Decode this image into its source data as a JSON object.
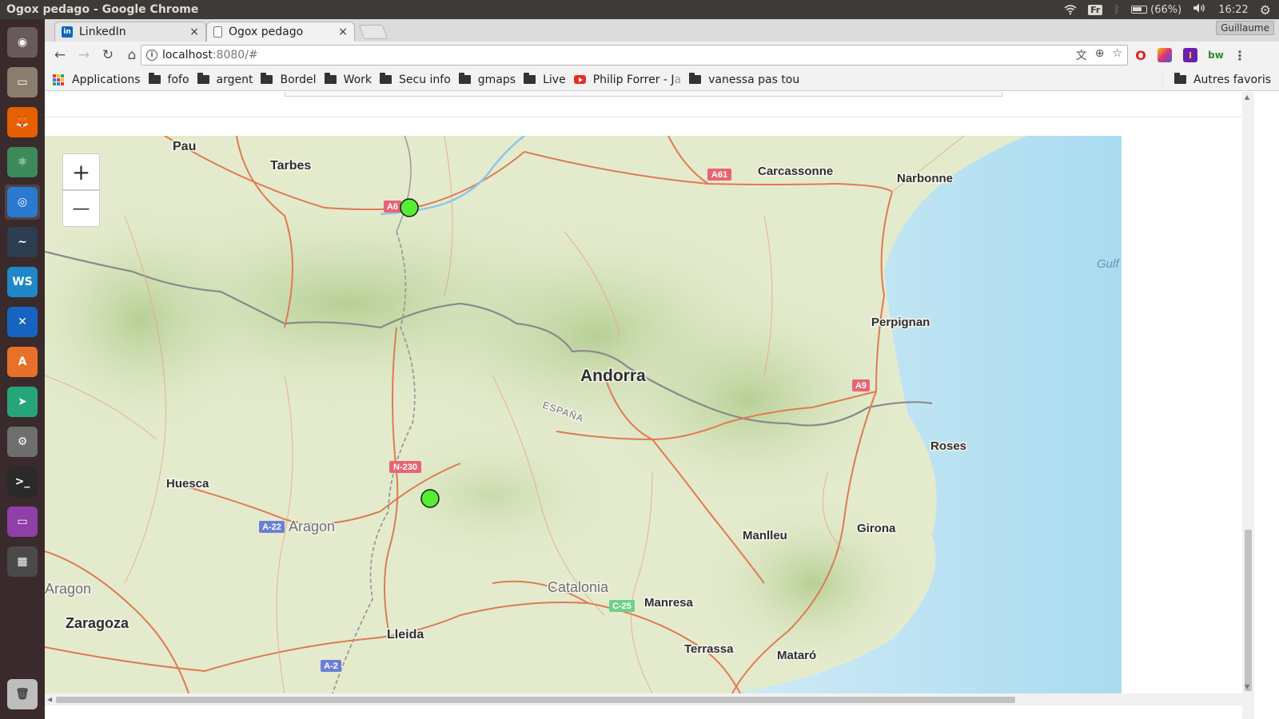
{
  "os": {
    "window_title": "Ogox pedago - Google Chrome",
    "keyboard_layout": "Fr",
    "battery": "(66%)",
    "clock": "16:22"
  },
  "launcher": {
    "items": [
      {
        "name": "ubuntu-home",
        "color": "#6a5a5a",
        "glyph": "◉"
      },
      {
        "name": "files",
        "color": "#8c7d6e",
        "glyph": "▭"
      },
      {
        "name": "firefox",
        "color": "#e66000",
        "glyph": "🦊"
      },
      {
        "name": "atom",
        "color": "#3c8a5a",
        "glyph": "⚛"
      },
      {
        "name": "chrome",
        "color": "#2a7ad0",
        "glyph": "◎"
      },
      {
        "name": "mysql-workbench",
        "color": "#2c3e50",
        "glyph": "~"
      },
      {
        "name": "webstorm",
        "color": "#1e88c8",
        "glyph": "WS"
      },
      {
        "name": "vscode",
        "color": "#1565c0",
        "glyph": "✕"
      },
      {
        "name": "software-center",
        "color": "#e8702a",
        "glyph": "A"
      },
      {
        "name": "telegram",
        "color": "#27a57a",
        "glyph": "➤"
      },
      {
        "name": "settings",
        "color": "#6e6e6e",
        "glyph": "⚙"
      },
      {
        "name": "terminal",
        "color": "#2a2a2a",
        "glyph": ">_"
      },
      {
        "name": "app-purple",
        "color": "#8e3fa8",
        "glyph": "▭"
      },
      {
        "name": "workspaces",
        "color": "#4a4a4a",
        "glyph": "▦"
      }
    ],
    "trash_glyph": "🗑"
  },
  "browser": {
    "tabs": [
      {
        "label": "LinkedIn",
        "close": "×"
      },
      {
        "label": "Ogox pedago",
        "close": "×"
      }
    ],
    "profile": "Guillaume",
    "url_host": "localhost",
    "url_rest": ":8080/#",
    "bookmarks": [
      {
        "label": "Applications",
        "type": "apps"
      },
      {
        "label": "fofo",
        "type": "folder"
      },
      {
        "label": "argent",
        "type": "folder"
      },
      {
        "label": "Bordel",
        "type": "folder"
      },
      {
        "label": "Work",
        "type": "folder"
      },
      {
        "label": "Secu info",
        "type": "folder"
      },
      {
        "label": "gmaps",
        "type": "folder"
      },
      {
        "label": "Live",
        "type": "folder"
      },
      {
        "label": "Philip Forrer - J",
        "fade": "a",
        "type": "youtube"
      },
      {
        "label": "vanessa pas tou",
        "type": "folder"
      }
    ],
    "other_bookmarks": "Autres favoris"
  },
  "map": {
    "zoom_in": "+",
    "zoom_out": "—",
    "labels": {
      "pau": "Pau",
      "tarbes": "Tarbes",
      "carcassonne": "Carcassonne",
      "narbonne": "Narbonne",
      "gulf": "Gulf",
      "perpignan": "Perpignan",
      "andorra": "Andorra",
      "espana": "ESPAÑA",
      "roses": "Roses",
      "huesca": "Huesca",
      "aragon_region": "Aragon",
      "aragon_edge": "Aragon",
      "manlleu": "Manlleu",
      "girona": "Girona",
      "catalonia": "Catalonia",
      "manresa": "Manresa",
      "zaragoza": "Zaragoza",
      "lleida": "Lleida",
      "terrassa": "Terrassa",
      "mataro": "Mataró"
    },
    "shields": {
      "a61": "A61",
      "a6x": "A6",
      "a9": "A9",
      "n230": "N-230",
      "a22": "A-22",
      "a2": "A-2",
      "c25": "C-25"
    },
    "colors": {
      "marker": "#55ee33",
      "land": "#dfe9c8",
      "sea": "#bfe3f3",
      "road": "#e0805a",
      "border": "#8a8a8a"
    }
  }
}
